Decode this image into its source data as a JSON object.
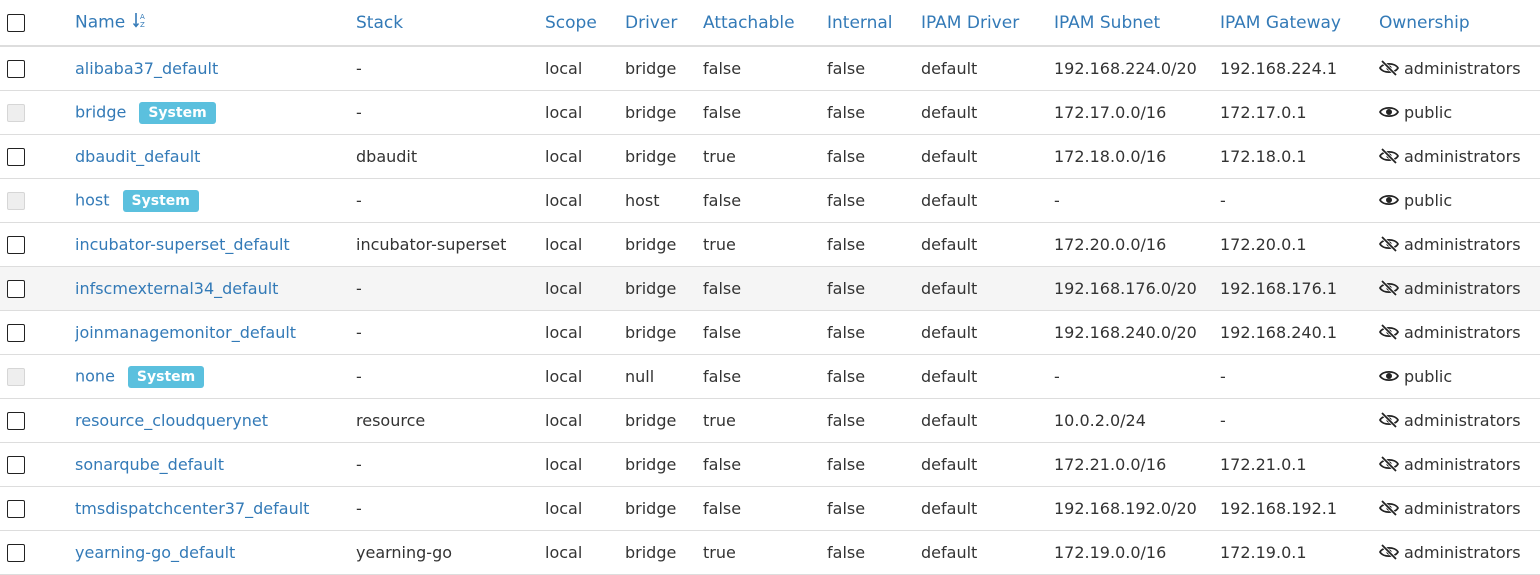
{
  "table": {
    "headers": {
      "name": "Name",
      "stack": "Stack",
      "scope": "Scope",
      "driver": "Driver",
      "attachable": "Attachable",
      "internal": "Internal",
      "ipam_driver": "IPAM Driver",
      "ipam_subnet": "IPAM Subnet",
      "ipam_gateway": "IPAM Gateway",
      "ownership": "Ownership"
    },
    "sort": {
      "column": "name",
      "icon": "sort-alpha-ascending-icon"
    },
    "colors": {
      "link": "#337ab7",
      "badge": "#5bc0de",
      "row_highlight": "#f5f5f5",
      "border": "#dddddd"
    },
    "rows": [
      {
        "name": "alibaba37_default",
        "system": false,
        "badge": "",
        "stack": "-",
        "scope": "local",
        "driver": "bridge",
        "attachable": "false",
        "internal": "false",
        "ipam_driver": "default",
        "ipam_subnet": "192.168.224.0/20",
        "ipam_gateway": "192.168.224.1",
        "ownership": "administrators",
        "ownership_icon": "eye-slash-icon"
      },
      {
        "name": "bridge",
        "system": true,
        "badge": "System",
        "stack": "-",
        "scope": "local",
        "driver": "bridge",
        "attachable": "false",
        "internal": "false",
        "ipam_driver": "default",
        "ipam_subnet": "172.17.0.0/16",
        "ipam_gateway": "172.17.0.1",
        "ownership": "public",
        "ownership_icon": "eye-icon"
      },
      {
        "name": "dbaudit_default",
        "system": false,
        "badge": "",
        "stack": "dbaudit",
        "scope": "local",
        "driver": "bridge",
        "attachable": "true",
        "internal": "false",
        "ipam_driver": "default",
        "ipam_subnet": "172.18.0.0/16",
        "ipam_gateway": "172.18.0.1",
        "ownership": "administrators",
        "ownership_icon": "eye-slash-icon"
      },
      {
        "name": "host",
        "system": true,
        "badge": "System",
        "stack": "-",
        "scope": "local",
        "driver": "host",
        "attachable": "false",
        "internal": "false",
        "ipam_driver": "default",
        "ipam_subnet": "-",
        "ipam_gateway": "-",
        "ownership": "public",
        "ownership_icon": "eye-icon"
      },
      {
        "name": "incubator-superset_default",
        "system": false,
        "badge": "",
        "stack": "incubator-superset",
        "scope": "local",
        "driver": "bridge",
        "attachable": "true",
        "internal": "false",
        "ipam_driver": "default",
        "ipam_subnet": "172.20.0.0/16",
        "ipam_gateway": "172.20.0.1",
        "ownership": "administrators",
        "ownership_icon": "eye-slash-icon"
      },
      {
        "name": "infscmexternal34_default",
        "system": false,
        "badge": "",
        "highlight": true,
        "stack": "-",
        "scope": "local",
        "driver": "bridge",
        "attachable": "false",
        "internal": "false",
        "ipam_driver": "default",
        "ipam_subnet": "192.168.176.0/20",
        "ipam_gateway": "192.168.176.1",
        "ownership": "administrators",
        "ownership_icon": "eye-slash-icon"
      },
      {
        "name": "joinmanagemonitor_default",
        "system": false,
        "badge": "",
        "stack": "-",
        "scope": "local",
        "driver": "bridge",
        "attachable": "false",
        "internal": "false",
        "ipam_driver": "default",
        "ipam_subnet": "192.168.240.0/20",
        "ipam_gateway": "192.168.240.1",
        "ownership": "administrators",
        "ownership_icon": "eye-slash-icon"
      },
      {
        "name": "none",
        "system": true,
        "badge": "System",
        "stack": "-",
        "scope": "local",
        "driver": "null",
        "attachable": "false",
        "internal": "false",
        "ipam_driver": "default",
        "ipam_subnet": "-",
        "ipam_gateway": "-",
        "ownership": "public",
        "ownership_icon": "eye-icon"
      },
      {
        "name": "resource_cloudquerynet",
        "system": false,
        "badge": "",
        "stack": "resource",
        "scope": "local",
        "driver": "bridge",
        "attachable": "true",
        "internal": "false",
        "ipam_driver": "default",
        "ipam_subnet": "10.0.2.0/24",
        "ipam_gateway": "-",
        "ownership": "administrators",
        "ownership_icon": "eye-slash-icon"
      },
      {
        "name": "sonarqube_default",
        "system": false,
        "badge": "",
        "stack": "-",
        "scope": "local",
        "driver": "bridge",
        "attachable": "false",
        "internal": "false",
        "ipam_driver": "default",
        "ipam_subnet": "172.21.0.0/16",
        "ipam_gateway": "172.21.0.1",
        "ownership": "administrators",
        "ownership_icon": "eye-slash-icon"
      },
      {
        "name": "tmsdispatchcenter37_default",
        "system": false,
        "badge": "",
        "stack": "-",
        "scope": "local",
        "driver": "bridge",
        "attachable": "false",
        "internal": "false",
        "ipam_driver": "default",
        "ipam_subnet": "192.168.192.0/20",
        "ipam_gateway": "192.168.192.1",
        "ownership": "administrators",
        "ownership_icon": "eye-slash-icon"
      },
      {
        "name": "yearning-go_default",
        "system": false,
        "badge": "",
        "stack": "yearning-go",
        "scope": "local",
        "driver": "bridge",
        "attachable": "true",
        "internal": "false",
        "ipam_driver": "default",
        "ipam_subnet": "172.19.0.0/16",
        "ipam_gateway": "172.19.0.1",
        "ownership": "administrators",
        "ownership_icon": "eye-slash-icon"
      }
    ]
  }
}
